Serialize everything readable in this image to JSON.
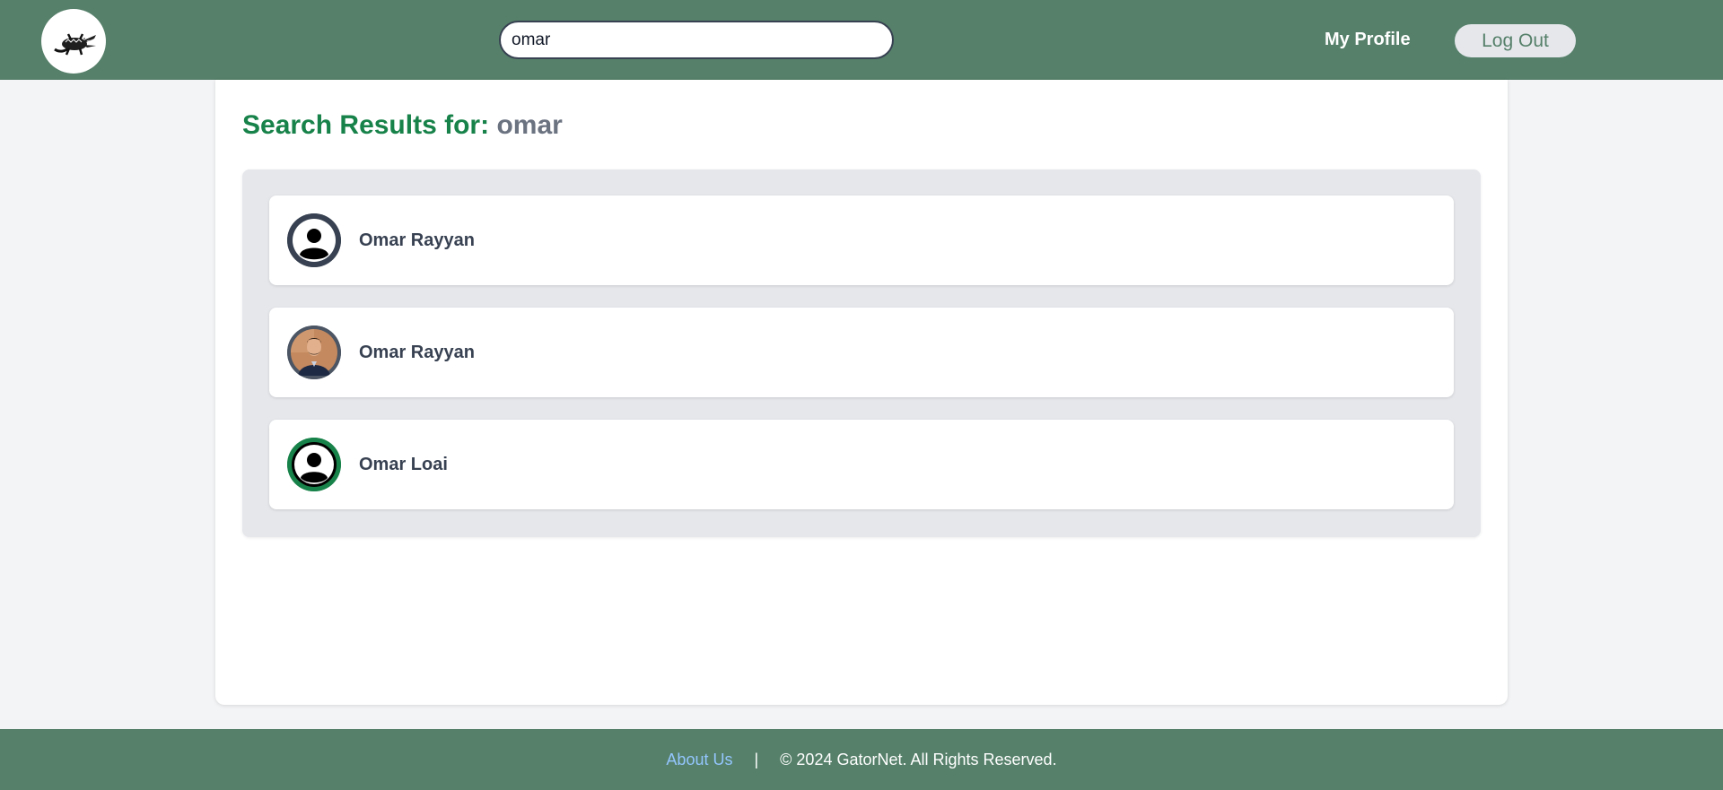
{
  "header": {
    "logo_icon": "alligator-logo-icon",
    "search_value": "omar",
    "my_profile_label": "My Profile",
    "logout_label": "Log Out"
  },
  "main": {
    "heading_label": "Search Results for:",
    "heading_query": "omar",
    "results": [
      {
        "name": "Omar Rayyan",
        "avatar": "default-user-icon",
        "ring_color": "#374151"
      },
      {
        "name": "Omar Rayyan",
        "avatar": "user-photo",
        "ring_color": "#4b5563"
      },
      {
        "name": "Omar Loai",
        "avatar": "default-user-icon",
        "ring_color": "#178249"
      }
    ]
  },
  "footer": {
    "about_label": "About Us",
    "separator": "|",
    "copyright": "© 2024 GatorNet. All Rights Reserved."
  },
  "colors": {
    "header_bg": "#56806a",
    "heading_green": "#178249",
    "page_bg": "#f3f4f6"
  }
}
